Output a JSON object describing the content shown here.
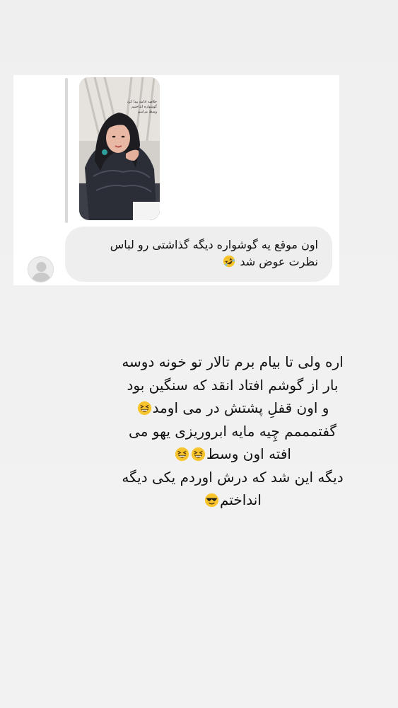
{
  "message_card": {
    "story_reply": {
      "caption_lines": [
        "خلاصه ادامه پیدا کرد",
        "گوشواره انداختیم",
        "وسط مراسم"
      ]
    },
    "bubble_lines": [
      "اون موقع یه گوشواره دیگه گذاشتی رو لباس",
      "نظرت عوض شد"
    ],
    "bubble_emoji": "rolling-on-floor-laughing-emoji"
  },
  "story_text": {
    "lines": [
      "اره ولی تا بیام برم تالار تو خونه دوسه",
      "بار از گوشم افتاد انقد که سنگین بود",
      "و اون قفلِ پشتش در می اومد",
      "گفتمممم چِیه مایه ابروریزی یهو می",
      "افته اون وسط",
      "دیگه این شد که درش اوردم یکی دیگه",
      "انداختم"
    ],
    "emojis": {
      "line3": "grinning-squinting-face-emoji",
      "line5": [
        "grinning-squinting-face-emoji",
        "grinning-squinting-face-emoji"
      ],
      "line7": "smiling-face-with-sunglasses-emoji"
    }
  },
  "colors": {
    "background": "#f0f0f1",
    "card": "#ffffff",
    "bubble": "#eeeeef",
    "text": "#111111",
    "emoji_yellow": "#f7c52b"
  }
}
